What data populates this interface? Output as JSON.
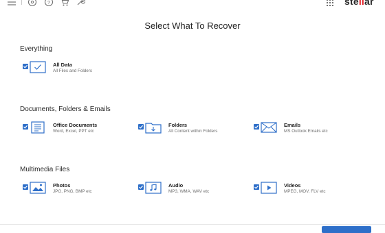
{
  "app": {
    "brand_prefix": "ste",
    "brand_mark": "ll",
    "brand_suffix": "ar"
  },
  "toolbar": {
    "icons": [
      "menu-icon",
      "disc-icon",
      "help-icon",
      "cart-icon",
      "wrench-icon",
      "apps-grid-icon"
    ]
  },
  "page": {
    "title": "Select What To Recover"
  },
  "sections": [
    {
      "title": "Everything",
      "items": [
        {
          "label": "All Data",
          "sub": "All Files and Folders",
          "icon": "check-square-icon",
          "checked": true
        }
      ]
    },
    {
      "title": "Documents, Folders & Emails",
      "items": [
        {
          "label": "Office Documents",
          "sub": "Word, Excel, PPT etc",
          "icon": "document-icon",
          "checked": true
        },
        {
          "label": "Folders",
          "sub": "All Content within Folders",
          "icon": "folder-icon",
          "checked": true
        },
        {
          "label": "Emails",
          "sub": "MS Outlook Emails etc",
          "icon": "envelope-icon",
          "checked": true
        }
      ]
    },
    {
      "title": "Multimedia Files",
      "items": [
        {
          "label": "Photos",
          "sub": "JPG, PNG, BMP etc",
          "icon": "image-icon",
          "checked": true
        },
        {
          "label": "Audio",
          "sub": "MP3, WMA, WAV etc",
          "icon": "music-note-icon",
          "checked": true
        },
        {
          "label": "Videos",
          "sub": "MPEG, MOV, FLV etc",
          "icon": "play-icon",
          "checked": true
        }
      ]
    }
  ],
  "colors": {
    "accent": "#2e6fc9",
    "brand": "#e01b22",
    "text": "#1f1f1f",
    "subtext": "#6d6d6d"
  }
}
